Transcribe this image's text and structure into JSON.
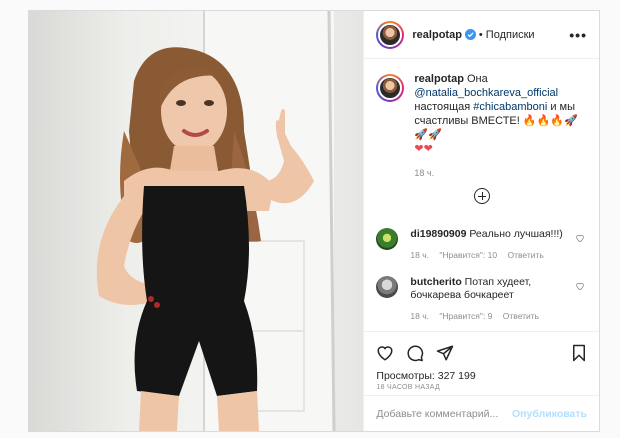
{
  "post": {
    "author": "realpotap",
    "follow_label": "Подписки",
    "dot": "•",
    "more": "•••"
  },
  "caption": {
    "username": "realpotap",
    "text_1": "Она",
    "mention": "@natalia_bochkareva_official",
    "text_2": "настоящая",
    "hashtag": "#chicabamboni",
    "text_3": "и мы счастливы ВМЕСТЕ!",
    "emoji": "🔥🔥🔥🚀🚀🚀",
    "hearts": "❤❤",
    "time": "18 ч."
  },
  "comments": [
    {
      "username": "di19890909",
      "text": "Реально лучшая!!!)",
      "time": "18 ч.",
      "likes": "\"Нравится\": 10",
      "reply": "Ответить"
    },
    {
      "username": "butcherito",
      "text": "Потап худеет, бочкарева бочкареет",
      "time": "18 ч.",
      "likes": "\"Нравится\": 9",
      "reply": "Ответить"
    }
  ],
  "stats": {
    "views": "Просмотры: 327 199",
    "ago": "18 ЧАСОВ НАЗАД"
  },
  "composer": {
    "placeholder": "Добавьте комментарий...",
    "publish": "Опубликовать"
  },
  "colors": {
    "link": "#00376b",
    "muted": "#8e8e8e",
    "publish_disabled": "#b2dffc",
    "heart": "#ed4956",
    "verified": "#3897f0"
  }
}
